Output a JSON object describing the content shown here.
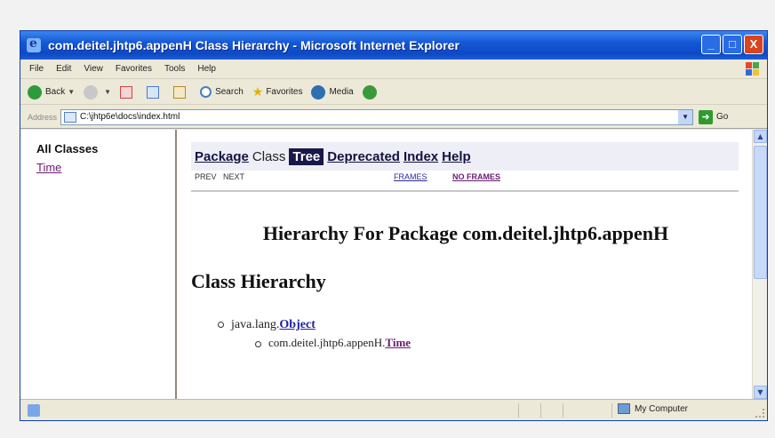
{
  "window": {
    "title": "com.deitel.jhtp6.appenH Class Hierarchy - Microsoft Internet Explorer",
    "buttons": [
      "_",
      "□",
      "X"
    ]
  },
  "menubar": {
    "items": [
      "File",
      "Edit",
      "View",
      "Favorites",
      "Tools",
      "Help"
    ]
  },
  "toolbar": {
    "back_label": "Back",
    "search_label": "Search",
    "favorites_label": "Favorites",
    "media_label": "Media"
  },
  "addressbar": {
    "label": "Address",
    "url": "C:\\jhtp6e\\docs\\index.html",
    "go_label": "Go"
  },
  "left_frame": {
    "heading": "All Classes",
    "classes": [
      "Time"
    ]
  },
  "navbar": {
    "package": "Package",
    "class": "Class",
    "tree": "Tree",
    "deprecated": "Deprecated",
    "index": "Index",
    "help": "Help"
  },
  "subnav": {
    "prev": "PREV",
    "next": "NEXT",
    "frames": "FRAMES",
    "no_frames": "NO FRAMES"
  },
  "page": {
    "heading_main": "Hierarchy For Package com.deitel.jhtp6.appenH",
    "heading_sub": "Class Hierarchy",
    "tree": [
      {
        "prefix": "java.lang.",
        "link": "Object"
      },
      {
        "prefix": "com.deitel.jhtp6.appenH.",
        "link": "Time"
      }
    ]
  },
  "statusbar": {
    "zone_label": "My Computer"
  },
  "colors": {
    "titlebar": "#1558d6",
    "nav_active_bg": "#181848",
    "visited_link": "#6a1b74",
    "link": "#2323a0"
  }
}
